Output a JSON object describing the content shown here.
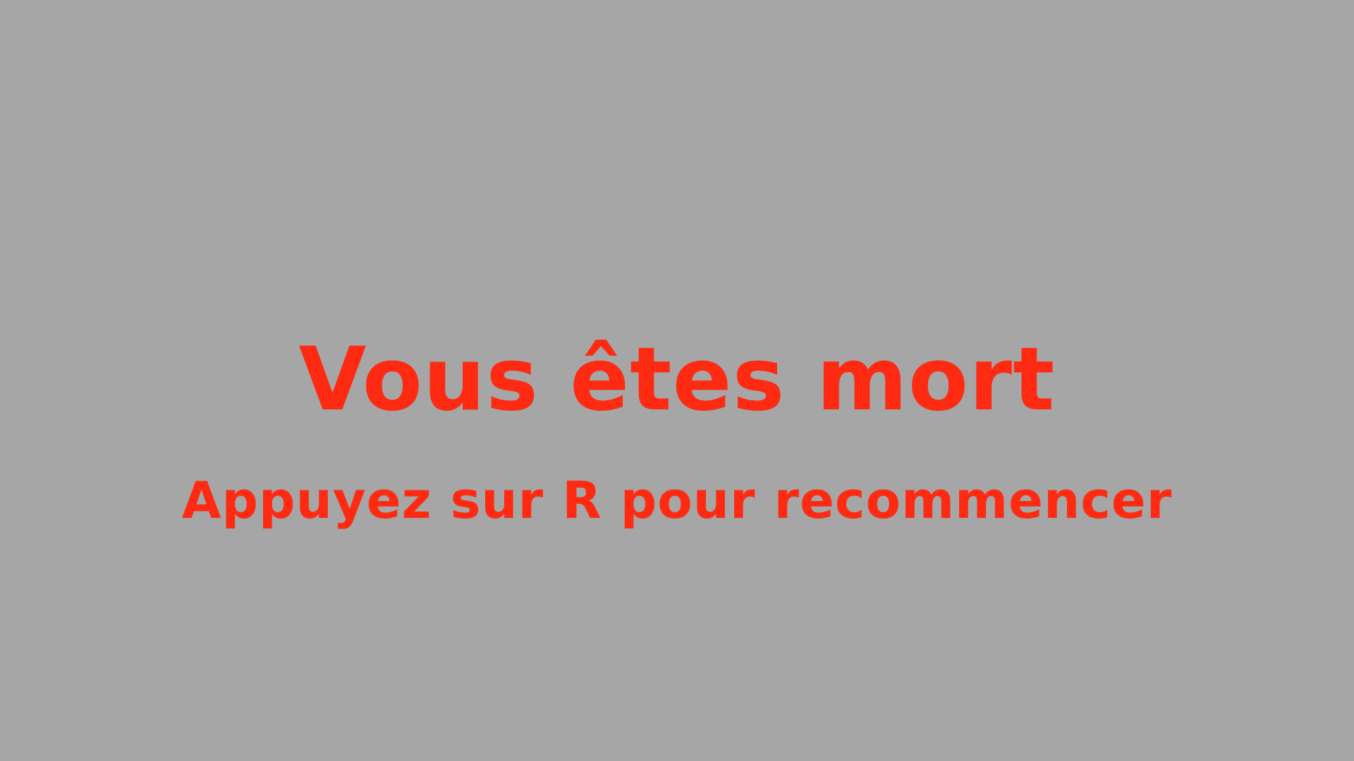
{
  "screen": {
    "background_color": "#a6a6a6",
    "text_color": "#ff2a12"
  },
  "game_over": {
    "title": "Vous êtes mort",
    "restart_hint": "Appuyez sur R pour recommencer"
  }
}
